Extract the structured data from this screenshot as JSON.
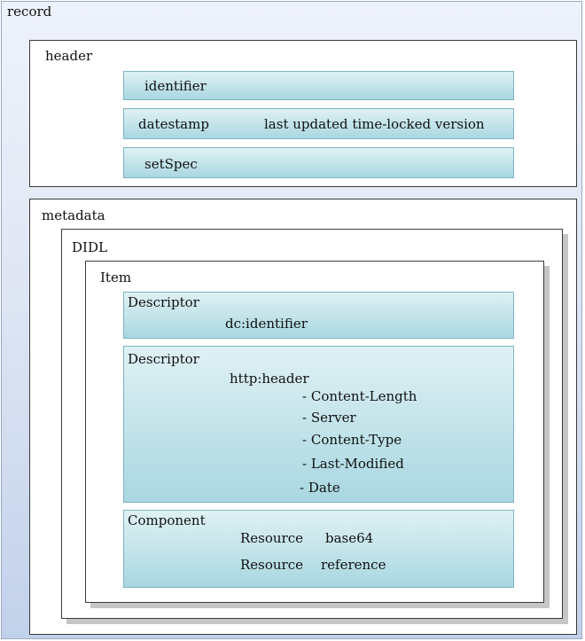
{
  "record": {
    "label": "record"
  },
  "header": {
    "label": "header",
    "identifier": "identifier",
    "datestamp": "datestamp",
    "datestamp_note": "last updated time-locked version",
    "setSpec": "setSpec"
  },
  "metadata": {
    "label": "metadata",
    "didl": "DIDL",
    "item": "Item",
    "descriptor1": {
      "label": "Descriptor",
      "value": "dc:identifier"
    },
    "descriptor2": {
      "label": "Descriptor",
      "value": "http:header",
      "fields": [
        "- Content-Length",
        "- Server",
        "- Content-Type",
        "- Last-Modified",
        "- Date"
      ]
    },
    "component": {
      "label": "Component",
      "resource1_label": "Resource",
      "resource1_value": "base64",
      "resource2_label": "Resource",
      "resource2_value": "reference"
    }
  },
  "colors": {
    "record_gradient_top": "#eef2fa",
    "record_gradient_bottom": "#c2d1ea",
    "box_gradient_top": "#dff1f4",
    "box_gradient_bottom": "#a9d7e1",
    "box_border": "#7fb4c2"
  }
}
